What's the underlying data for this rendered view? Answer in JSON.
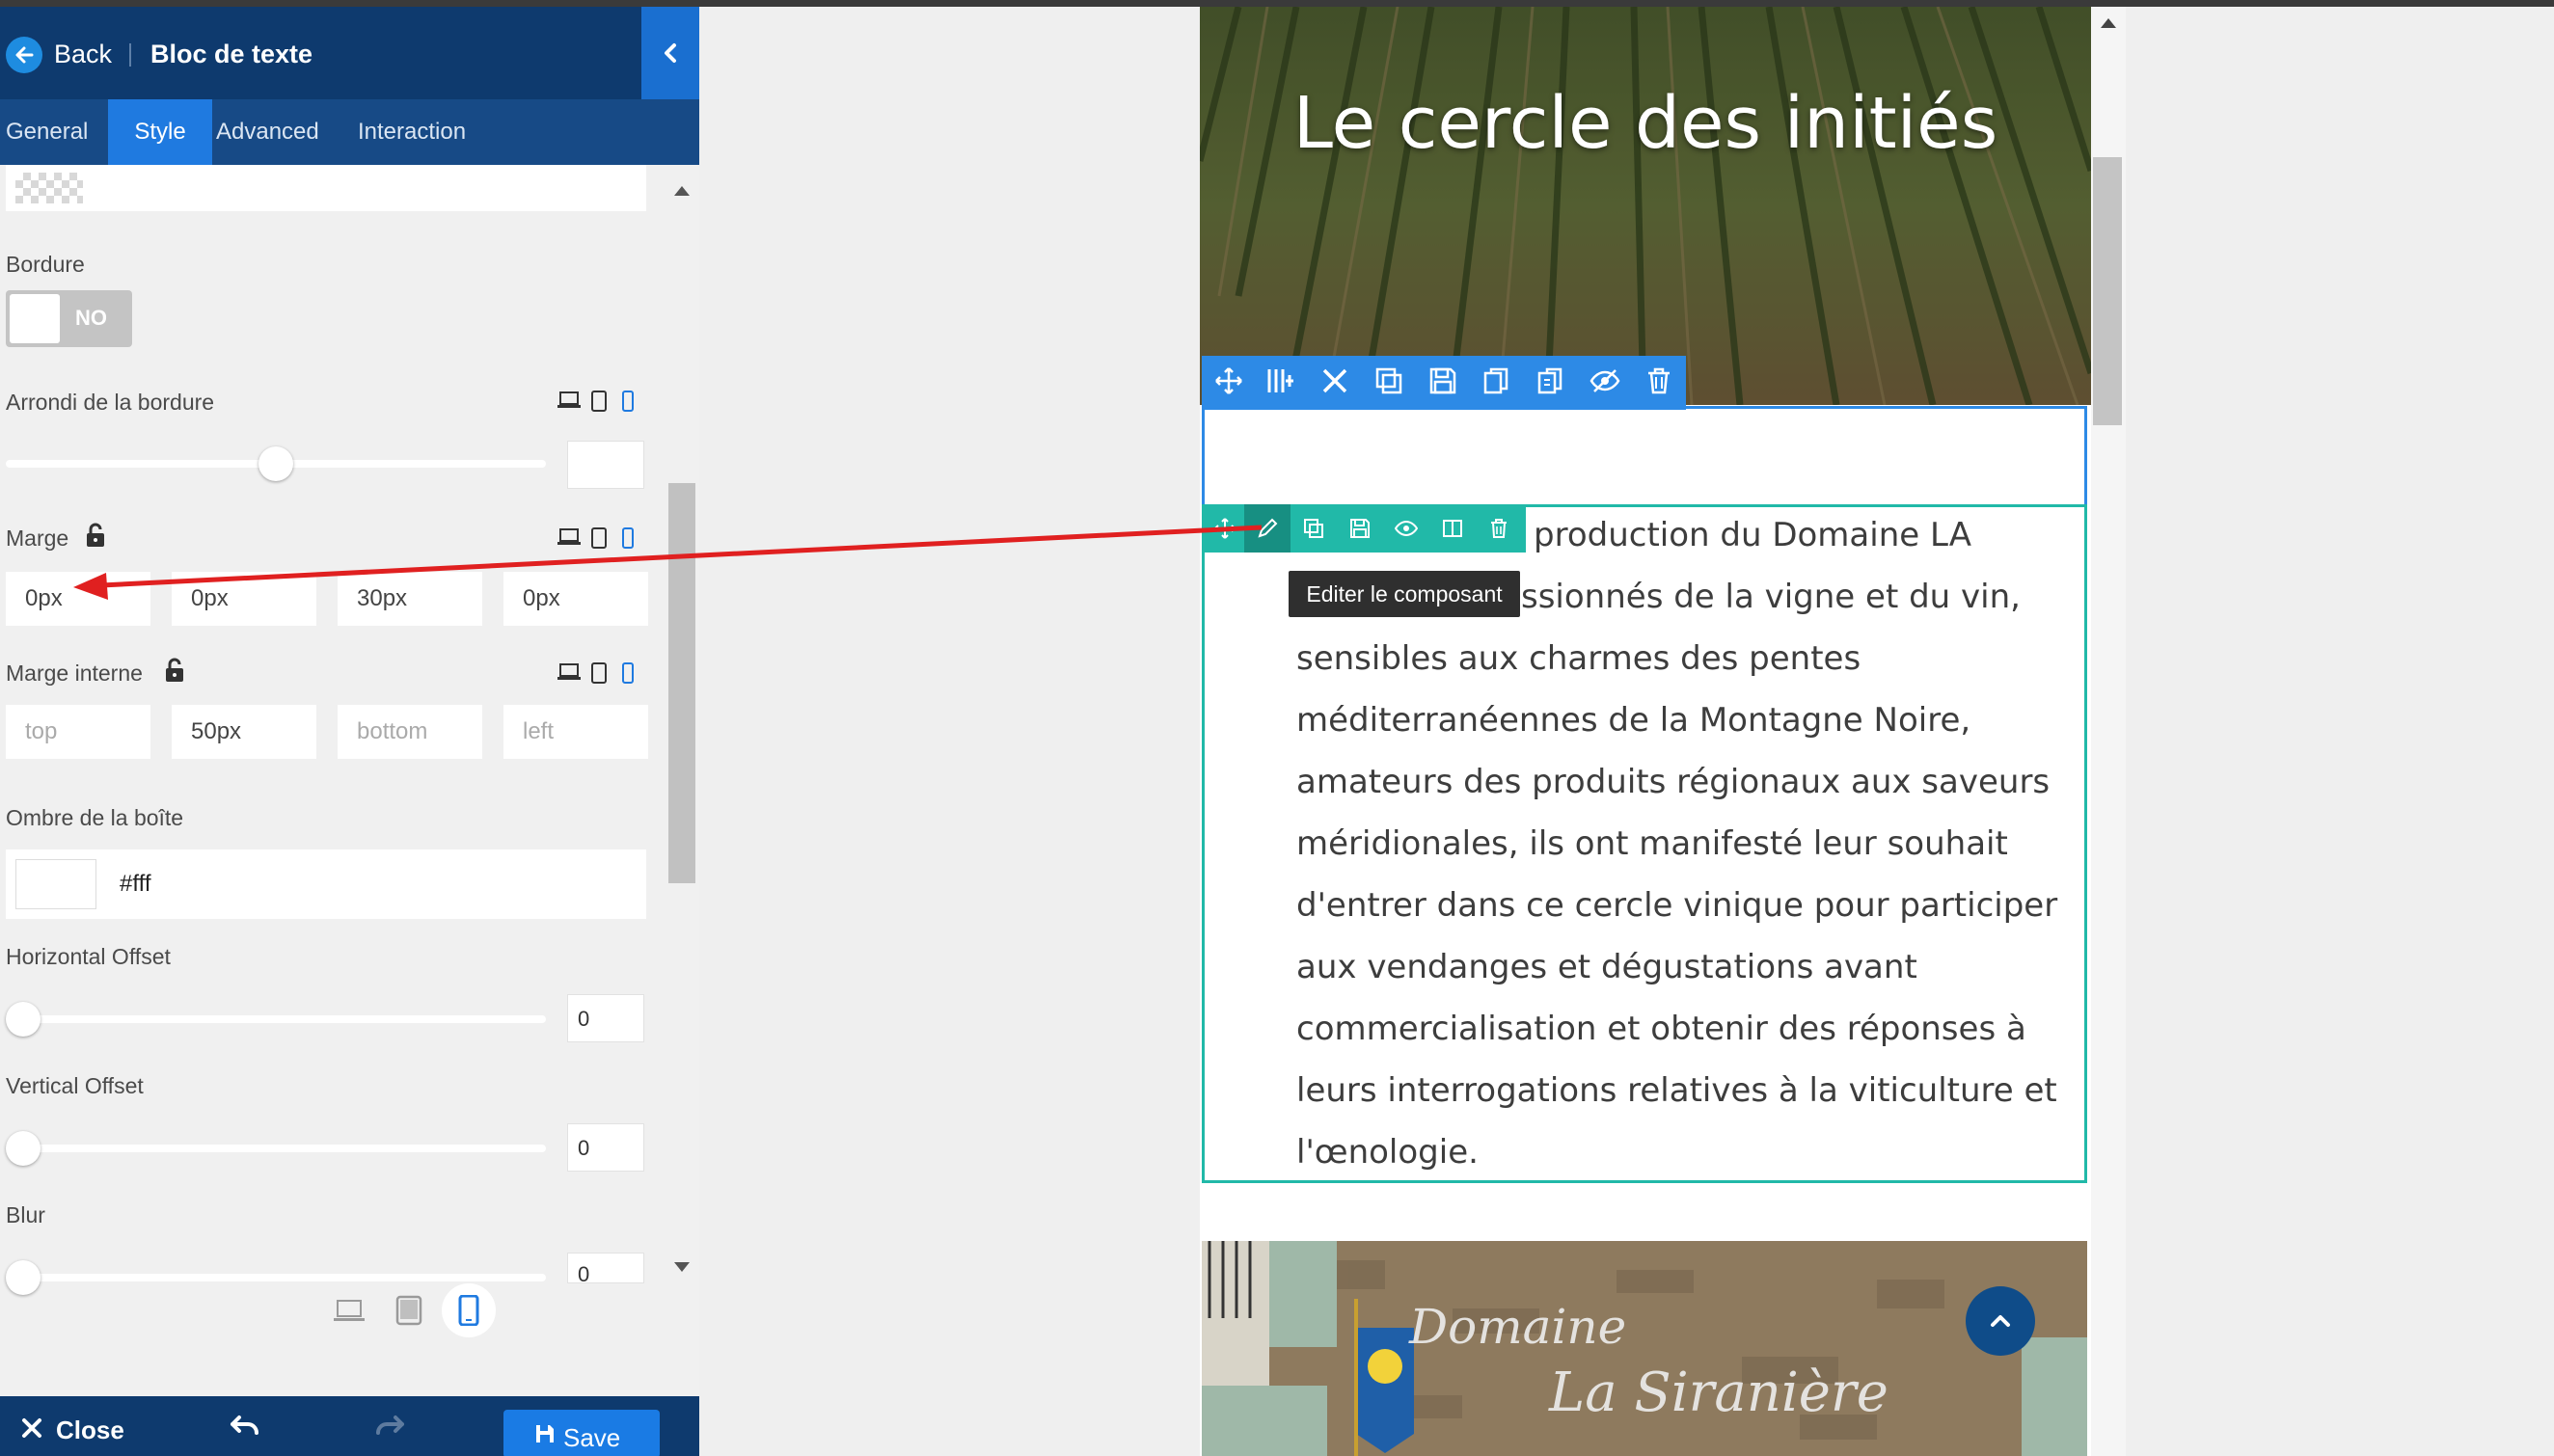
{
  "header": {
    "back_label": "Back",
    "title": "Bloc de texte"
  },
  "tabs": [
    {
      "label": "General"
    },
    {
      "label": "Style"
    },
    {
      "label": "Advanced"
    },
    {
      "label": "Interaction"
    }
  ],
  "style_panel": {
    "border": {
      "label": "Bordure",
      "toggle": "NO"
    },
    "border_radius": {
      "label": "Arrondi de la bordure",
      "slider_fraction": 0.5,
      "value": ""
    },
    "margin": {
      "label": "Marge",
      "values": [
        "0px",
        "0px",
        "30px",
        "0px"
      ]
    },
    "padding": {
      "label": "Marge interne",
      "values": [
        "top",
        "50px",
        "bottom",
        "left"
      ]
    },
    "box_shadow": {
      "label": "Ombre de la boîte",
      "color": "#fff"
    },
    "horizontal_offset": {
      "label": "Horizontal Offset",
      "value": "0"
    },
    "vertical_offset": {
      "label": "Vertical Offset",
      "value": "0"
    },
    "blur": {
      "label": "Blur",
      "value": "0"
    }
  },
  "footer": {
    "close_label": "Close",
    "save_label": "Save"
  },
  "preview": {
    "hero_title": "Le cercle des initiés",
    "tooltip": "Editer le composant",
    "paragraph_lines": [
      "production du Domaine LA",
      "ssionnés de la vigne et du vin,",
      "sensibles aux charmes des pentes",
      "méditerranéennes de la Montagne Noire,",
      "amateurs des produits régionaux aux saveurs",
      "méridionales, ils ont manifesté leur souhait",
      "d'entrer dans ce cercle vinique pour participer",
      "aux vendanges et dégustations avant",
      "commercialisation et obtenir des réponses à",
      "leurs interrogations relatives à la viticulture et",
      "l'œnologie."
    ],
    "sign_line1": "Domaine",
    "sign_line2": "La Siranière"
  },
  "colors": {
    "accent": "#1f7ae0",
    "header": "#0e3a6e",
    "row_toolbar": "#2d8ae6",
    "element_toolbar": "#21b9a8",
    "annotation_arrow": "#e02020"
  }
}
